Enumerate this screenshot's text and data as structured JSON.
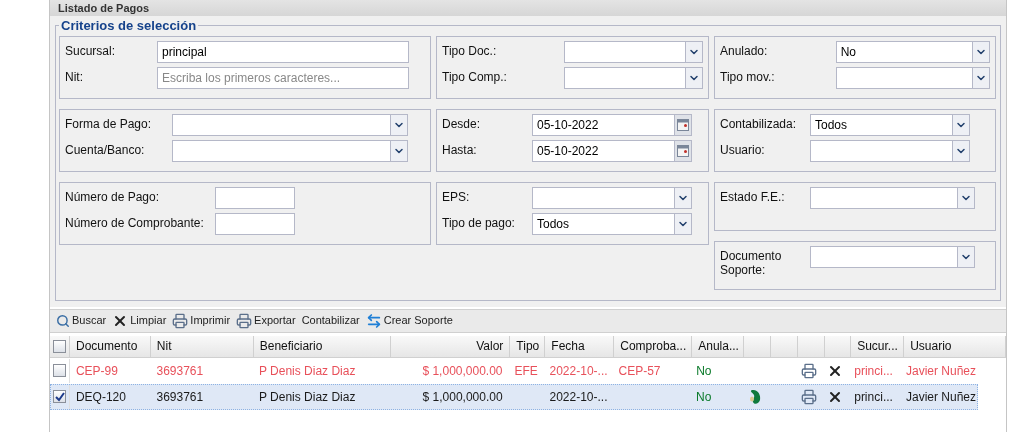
{
  "panel": {
    "title": "Listado de Pagos"
  },
  "criteria": {
    "legend": "Criterios de selección",
    "rows": [
      {
        "columns": [
          {
            "groups": [
              {
                "fields": [
                  {
                    "label": "Sucursal:",
                    "kind": "text",
                    "value": "principal"
                  },
                  {
                    "label": "Nit:",
                    "kind": "text",
                    "placeholder": "Escriba los primeros caracteres..."
                  }
                ]
              }
            ]
          },
          {
            "groups": [
              {
                "fields": [
                  {
                    "label": "Tipo Doc.:",
                    "kind": "select"
                  },
                  {
                    "label": "Tipo Comp.:",
                    "kind": "select"
                  }
                ]
              }
            ]
          },
          {
            "groups": [
              {
                "fields": [
                  {
                    "label": "Anulado:",
                    "kind": "select",
                    "value": "No"
                  },
                  {
                    "label": "Tipo mov.:",
                    "kind": "select"
                  }
                ]
              }
            ]
          }
        ]
      },
      {
        "columns": [
          {
            "groups": [
              {
                "fields": [
                  {
                    "label": "Forma de Pago:",
                    "kind": "select"
                  },
                  {
                    "label": "Cuenta/Banco:",
                    "kind": "select"
                  }
                ]
              }
            ]
          },
          {
            "groups": [
              {
                "fields": [
                  {
                    "label": "Desde:",
                    "kind": "date",
                    "value": "05-10-2022"
                  },
                  {
                    "label": "Hasta:",
                    "kind": "date",
                    "value": "05-10-2022"
                  }
                ]
              }
            ]
          },
          {
            "groups": [
              {
                "fields": [
                  {
                    "label": "Contabilizada:",
                    "kind": "select",
                    "value": "Todos"
                  },
                  {
                    "label": "Usuario:",
                    "kind": "select"
                  }
                ]
              }
            ]
          }
        ]
      },
      {
        "columns": [
          {
            "groups": [
              {
                "fields": [
                  {
                    "label": "Número de Pago:",
                    "kind": "text"
                  },
                  {
                    "label": "Número de Comprobante:",
                    "kind": "text"
                  }
                ]
              }
            ]
          },
          {
            "groups": [
              {
                "fields": [
                  {
                    "label": "EPS:",
                    "kind": "select"
                  },
                  {
                    "label": "Tipo de pago:",
                    "kind": "select",
                    "value": "Todos"
                  }
                ]
              }
            ]
          },
          {
            "groups": [
              {
                "fields": [
                  {
                    "label": "Estado F.E.:",
                    "kind": "select"
                  }
                ]
              },
              {
                "fields": [
                  {
                    "label": "Documento Soporte:",
                    "kind": "select"
                  }
                ]
              }
            ]
          }
        ]
      }
    ]
  },
  "toolbar": [
    {
      "label": "Buscar",
      "kind": "search"
    },
    {
      "label": "Limpiar",
      "kind": "clear"
    },
    {
      "label": "Imprimir",
      "kind": "print"
    },
    {
      "label": "Exportar",
      "kind": "print"
    },
    {
      "label": "Contabilizar",
      "kind": "plain"
    },
    {
      "label": "Crear Soporte",
      "kind": "swap"
    }
  ],
  "table": {
    "select_all": {
      "checked": false
    },
    "columns": [
      "Documento",
      "Nit",
      "Beneficiario",
      "Valor",
      "Tipo",
      "Fecha",
      "Comproba...",
      "Anula...",
      "",
      "",
      "",
      "",
      "Sucur...",
      "Usuario"
    ],
    "rows": [
      {
        "checked": false,
        "selected": false,
        "color": "#e8505a",
        "documento": "CEP-99",
        "nit": "3693761",
        "beneficiario": "P Denis Diaz Diaz",
        "valor": "$ 1,000,000.00",
        "tipo": "EFE",
        "fecha": "2022-10-...",
        "comprobante": "CEP-57",
        "anulado": "No",
        "fe_icon": false,
        "sucursal": "princi...",
        "usuario": "Javier Nuñez"
      },
      {
        "checked": true,
        "selected": true,
        "color": "#1a1a1a",
        "documento": "DEQ-120",
        "nit": "3693761",
        "beneficiario": "P Denis Diaz Diaz",
        "valor": "$ 1,000,000.00",
        "tipo": "",
        "fecha": "2022-10-...",
        "comprobante": "",
        "anulado": "No",
        "fe_icon": true,
        "sucursal": "princi...",
        "usuario": "Javier Nuñez"
      }
    ]
  }
}
